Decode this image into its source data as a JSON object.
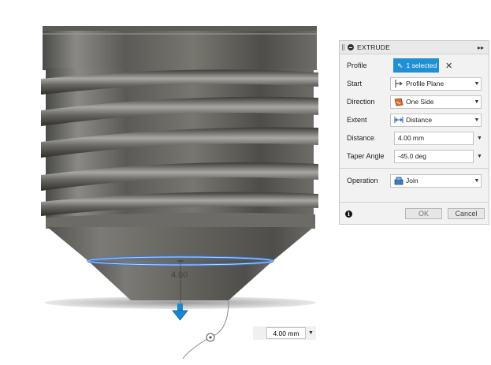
{
  "viewport": {
    "dimension_label": "4.00",
    "dimension_input_value": "4.00 mm"
  },
  "panel": {
    "title": "EXTRUDE",
    "profile": {
      "label": "Profile",
      "selection": "1 selected"
    },
    "start": {
      "label": "Start",
      "value": "Profile Plane"
    },
    "direction": {
      "label": "Direction",
      "value": "One Side"
    },
    "extent": {
      "label": "Extent",
      "value": "Distance"
    },
    "distance": {
      "label": "Distance",
      "value": "4.00 mm"
    },
    "taper": {
      "label": "Taper Angle",
      "value": "-45.0 deg"
    },
    "operation": {
      "label": "Operation",
      "value": "Join"
    },
    "ok_label": "OK",
    "cancel_label": "Cancel"
  },
  "colors": {
    "accent": "#1f8fd6",
    "selection_highlight": "#3a78d6",
    "arrow": "#1e86d0"
  }
}
